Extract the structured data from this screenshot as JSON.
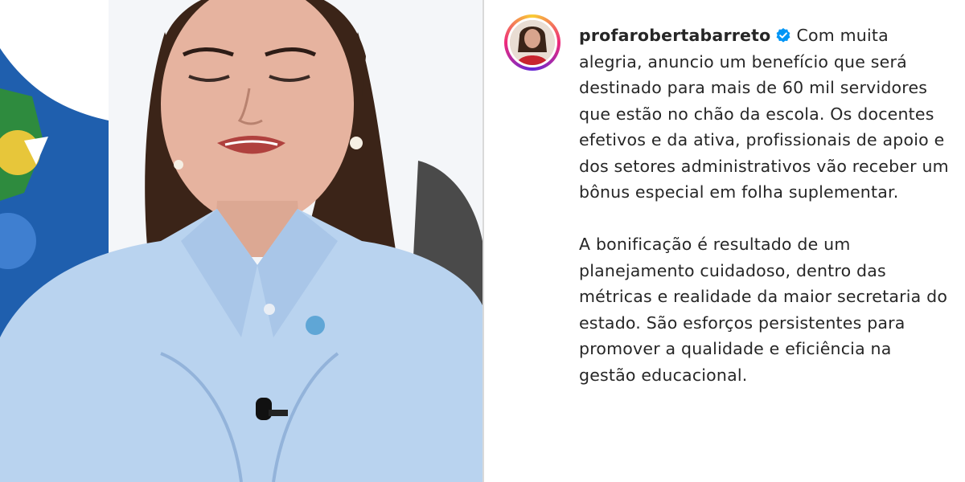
{
  "post": {
    "username": "profarobertabarreto",
    "verified_icon": "verified-badge-icon",
    "caption_lead": "Com muita alegria, anuncio um benefício que será destinado para mais de 60 mil servidores que estão no chão da escola. Os docentes efetivos e da ativa, profissionais de apoio e dos setores administrativos vão receber um bônus especial em folha suplementar.",
    "caption_second": "A bonificação é resultado de um planejamento cuidadoso, dentro das métricas e realidade da maior secretaria do estado. São esforços persistentes para promover a qualidade e eficiência na gestão educacional."
  },
  "colors": {
    "text": "#262626",
    "verified": "#0095f6",
    "blouse": "#b9d3ef",
    "hair": "#3b2418"
  }
}
